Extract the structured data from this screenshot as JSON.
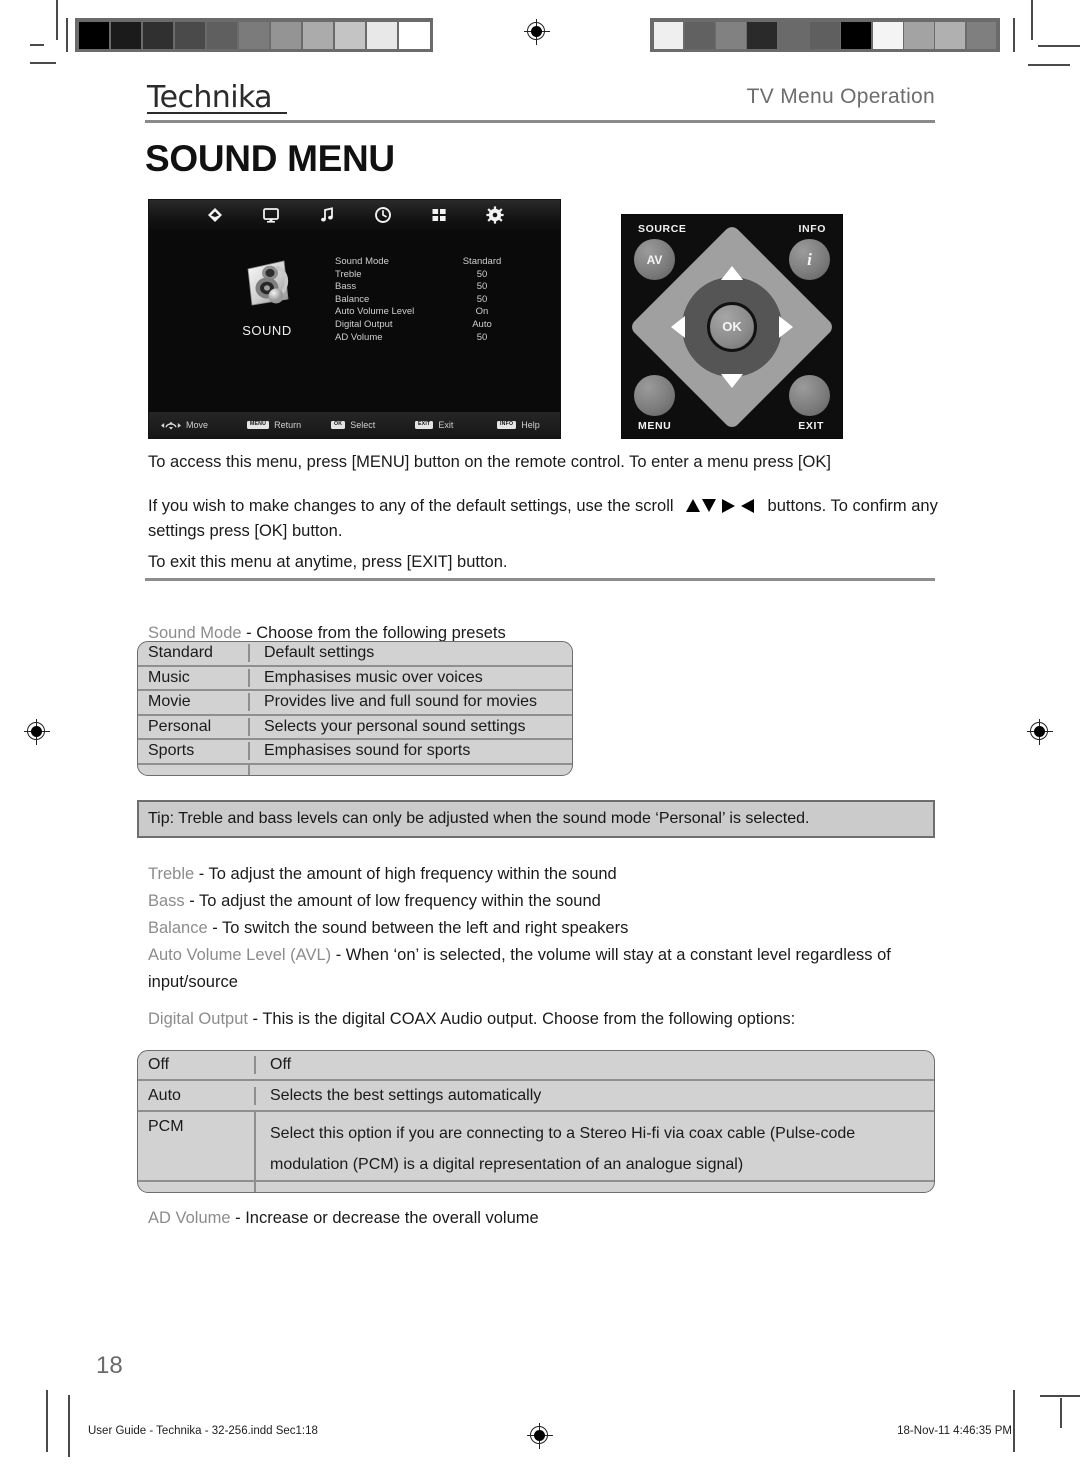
{
  "header": {
    "brand": "Technika",
    "section_title": "TV Menu Operation",
    "page_title": "SOUND MENU"
  },
  "osd": {
    "category_label": "SOUND",
    "top_icons": [
      "picture-diamond-icon",
      "display-monitor-icon",
      "music-note-icon",
      "clock-icon",
      "grid-apps-icon",
      "settings-gear-icon"
    ],
    "rows": [
      {
        "label": "Sound Mode",
        "value": "Standard"
      },
      {
        "label": "Treble",
        "value": "50"
      },
      {
        "label": "Bass",
        "value": "50"
      },
      {
        "label": "Balance",
        "value": "50"
      },
      {
        "label": "Auto Volume Level",
        "value": "On"
      },
      {
        "label": "Digital Output",
        "value": "Auto"
      },
      {
        "label": "AD Volume",
        "value": "50"
      }
    ],
    "hints": [
      {
        "key": "",
        "label": "Move"
      },
      {
        "key": "MENU",
        "label": "Return"
      },
      {
        "key": "OK",
        "label": "Select"
      },
      {
        "key": "EXIT",
        "label": "Exit"
      },
      {
        "key": "INFO",
        "label": "Help"
      }
    ]
  },
  "remote": {
    "source_label": "SOURCE",
    "info_label": "INFO",
    "menu_label": "MENU",
    "exit_label": "EXIT",
    "av_button": "AV",
    "info_button": "i",
    "ok_button": "OK"
  },
  "intro": {
    "p1": "To access this menu, press [MENU] button on the remote control. To enter a menu press [OK]",
    "p2_before": "If you wish to make changes to any of the default settings, use the scroll",
    "p2_after": "buttons. To confirm any settings press [OK] button.",
    "p3": "To exit this menu at anytime, press [EXIT] button."
  },
  "sound_mode": {
    "term": "Sound Mode",
    "description": " - Choose from the following presets",
    "rows": [
      {
        "name": "Standard",
        "desc": "Default settings"
      },
      {
        "name": "Music",
        "desc": "Emphasises music over voices"
      },
      {
        "name": "Movie",
        "desc": "Provides live and full sound for movies"
      },
      {
        "name": "Personal",
        "desc": "Selects your personal sound settings"
      },
      {
        "name": "Sports",
        "desc": "Emphasises sound for sports"
      }
    ]
  },
  "tip": "Tip: Treble and bass levels can only be adjusted when the sound mode ‘Personal’ is selected.",
  "settings": [
    {
      "term": "Treble",
      "desc": " - To adjust the amount of high frequency within the sound"
    },
    {
      "term": "Bass",
      "desc": " - To adjust the amount of low frequency within the sound"
    },
    {
      "term": "Balance",
      "desc": " - To switch the sound between the left and right speakers"
    }
  ],
  "avl": {
    "term": "Auto Volume Level (AVL)",
    "desc": " - When ‘on’ is selected, the volume will stay at a constant level regardless of",
    "desc_line2": "input/source"
  },
  "digital_output": {
    "term": "Digital Output",
    "description": " - This is the digital COAX Audio output. Choose from the following options:",
    "rows": [
      {
        "name": "Off",
        "desc": "Off",
        "desc2": ""
      },
      {
        "name": "Auto",
        "desc": "Selects the best settings automatically",
        "desc2": ""
      },
      {
        "name": "PCM",
        "desc": "Select this option if you are connecting to a Stereo Hi-fi via coax cable (Pulse-code",
        "desc2": "modulation (PCM) is a digital representation of an analogue signal)"
      }
    ]
  },
  "ad_volume": {
    "term": "AD Volume",
    "desc": " - Increase or decrease the overall volume"
  },
  "footer": {
    "page_number": "18",
    "file_info": "User Guide - Technika - 32-256.indd   Sec1:18",
    "timestamp": "18-Nov-11   4:46:35 PM"
  },
  "colorbars": {
    "left": [
      "#000000",
      "#1b1b1b",
      "#303030",
      "#4a4a4a",
      "#5f5f5f",
      "#7b7b7b",
      "#949494",
      "#ababab",
      "#c4c4c4",
      "#e8e8e8",
      "#ffffff"
    ],
    "right": [
      "#efefef",
      "#616161",
      "#818181",
      "#2a2a2a",
      "#6a6a6a",
      "#5f5f5f",
      "#000000",
      "#f4f4f4",
      "#a3a3a3",
      "#b0b0b0",
      "#7f7f7f"
    ]
  }
}
